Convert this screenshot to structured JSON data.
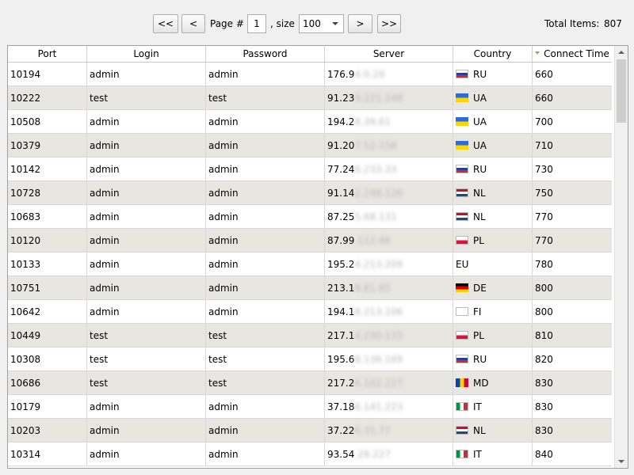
{
  "toolbar": {
    "first": "<<",
    "prev": "<",
    "page_label": "Page #",
    "page_value": "1",
    "size_label": ", size",
    "size_value": "100",
    "next": ">",
    "last": ">>",
    "total_label": "Total Items:",
    "total_value": "807"
  },
  "columns": [
    "Port",
    "Login",
    "Password",
    "Server",
    "Country",
    "Connect Time"
  ],
  "sort": {
    "column": "Connect Time",
    "direction": "descending-indicator",
    "color": "#7ab55c"
  },
  "rows": [
    {
      "port": "10194",
      "login": "admin",
      "password": "admin",
      "server": "176.9",
      "server_hidden": "4.0.29",
      "flag": "RU",
      "country": "RU",
      "time": "660"
    },
    {
      "port": "10222",
      "login": "test",
      "password": "test",
      "server": "91.23",
      "server_hidden": "9.221.248",
      "flag": "UA",
      "country": "UA",
      "time": "660"
    },
    {
      "port": "10508",
      "login": "admin",
      "password": "admin",
      "server": "194.2",
      "server_hidden": "8.39.61",
      "flag": "UA",
      "country": "UA",
      "time": "700"
    },
    {
      "port": "10379",
      "login": "admin",
      "password": "admin",
      "server": "91.20",
      "server_hidden": "7.52.158",
      "flag": "UA",
      "country": "UA",
      "time": "710"
    },
    {
      "port": "10142",
      "login": "admin",
      "password": "admin",
      "server": "77.24",
      "server_hidden": "6.233.33",
      "flag": "RU",
      "country": "RU",
      "time": "730"
    },
    {
      "port": "10728",
      "login": "admin",
      "password": "admin",
      "server": "91.14",
      "server_hidden": "2.248.126",
      "flag": "NL",
      "country": "NL",
      "time": "750"
    },
    {
      "port": "10683",
      "login": "admin",
      "password": "admin",
      "server": "87.25",
      "server_hidden": "5.68.131",
      "flag": "NL",
      "country": "NL",
      "time": "770"
    },
    {
      "port": "10120",
      "login": "admin",
      "password": "admin",
      "server": "87.99",
      "server_hidden": ".112.88",
      "flag": "PL",
      "country": "PL",
      "time": "770"
    },
    {
      "port": "10133",
      "login": "admin",
      "password": "admin",
      "server": "195.2",
      "server_hidden": "4.213.209",
      "flag": "",
      "country": "EU",
      "time": "780"
    },
    {
      "port": "10751",
      "login": "admin",
      "password": "admin",
      "server": "213.1",
      "server_hidden": "8.81.85",
      "flag": "DE",
      "country": "DE",
      "time": "800"
    },
    {
      "port": "10642",
      "login": "admin",
      "password": "admin",
      "server": "194.1",
      "server_hidden": "8.213.106",
      "flag": "FI",
      "country": "FI",
      "time": "800"
    },
    {
      "port": "10449",
      "login": "test",
      "password": "test",
      "server": "217.1",
      "server_hidden": "4.230.133",
      "flag": "PL",
      "country": "PL",
      "time": "810"
    },
    {
      "port": "10308",
      "login": "test",
      "password": "test",
      "server": "195.6",
      "server_hidden": "8.136.169",
      "flag": "RU",
      "country": "RU",
      "time": "820"
    },
    {
      "port": "10686",
      "login": "test",
      "password": "test",
      "server": "217.2",
      "server_hidden": "6.162.227",
      "flag": "MD",
      "country": "MD",
      "time": "830"
    },
    {
      "port": "10179",
      "login": "admin",
      "password": "admin",
      "server": "37.18",
      "server_hidden": "6.141.223",
      "flag": "IT",
      "country": "IT",
      "time": "830"
    },
    {
      "port": "10203",
      "login": "admin",
      "password": "admin",
      "server": "37.22",
      "server_hidden": "6.31.77",
      "flag": "NL",
      "country": "NL",
      "time": "830"
    },
    {
      "port": "10314",
      "login": "admin",
      "password": "admin",
      "server": "93.54",
      "server_hidden": ".29.227",
      "flag": "IT",
      "country": "IT",
      "time": "840"
    }
  ],
  "colors": {
    "alt_row": "#e8e6e1",
    "grid_line": "#d8d8d8"
  }
}
